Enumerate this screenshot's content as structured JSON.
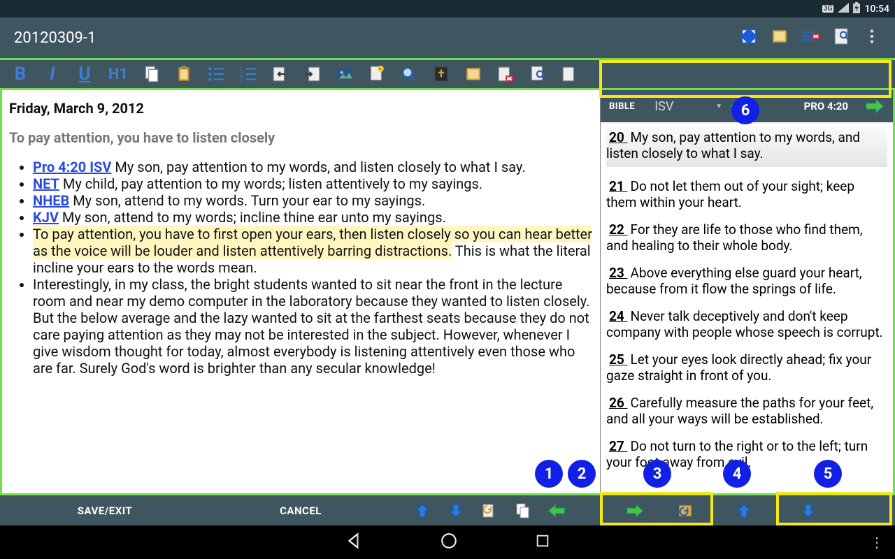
{
  "status": {
    "network": "3G",
    "time": "10:54"
  },
  "title": "20120309-1",
  "toolbar": {
    "bold": "B",
    "italic": "I",
    "underline": "U",
    "h1": "H1"
  },
  "editor": {
    "date": "Friday, March 9, 2012",
    "subtitle": "To pay attention, you have to listen closely",
    "items": [
      {
        "ref": "Pro 4:20 ISV",
        "text": " My son, pay attention to my words, and listen closely to what I say."
      },
      {
        "ref": "NET",
        "text": " My child, pay attention to my words; listen attentively to my sayings."
      },
      {
        "ref": "NHEB",
        "text": " My son, attend to my words. Turn your ear to my sayings."
      },
      {
        "ref": "KJV",
        "text": " My son, attend to my words; incline thine ear unto my sayings."
      }
    ],
    "highlight": "To pay attention, you have to first open your ears, then listen closely so you can hear better as the voice will be louder and listen attentively barring distractions.",
    "after_hl": " This is what the literal incline your ears to the words mean.",
    "note": "Interestingly, in my class, the bright students wanted to sit near the front in the lecture room and near my demo computer in the laboratory because they wanted to listen closely. But the below average and the lazy wanted to sit at the farthest seats because they do not care paying attention as they may not be interested in the subject. However, whenever I give wisdom thought for today, almost everybody is listening attentively even those who are far. Surely God's word is brighter than any secular knowledge!"
  },
  "bible": {
    "label": "BIBLE",
    "version": "ISV",
    "ref": "PRO 4:20",
    "verses": [
      {
        "n": "20",
        "t": " My son, pay attention to my words, and listen closely to what I say.",
        "active": true
      },
      {
        "n": "21",
        "t": " Do not let them out of your sight; keep them within your heart."
      },
      {
        "n": "22",
        "t": " For they are life to those who find them, and healing to their whole body."
      },
      {
        "n": "23",
        "t": " Above everything else guard your heart, because from it flow the springs of life."
      },
      {
        "n": "24",
        "t": " Never talk deceptively and don't keep company with people whose speech is corrupt."
      },
      {
        "n": "25",
        "t": " Let your eyes look directly ahead; fix your gaze straight in front of you."
      },
      {
        "n": "26",
        "t": " Carefully measure the paths for your feet, and all your ways will be established."
      },
      {
        "n": "27",
        "t": " Do not turn to the right or to the left; turn your foot away from evil."
      }
    ]
  },
  "bottom": {
    "save": "SAVE/EXIT",
    "cancel": "CANCEL"
  },
  "callouts": [
    "1",
    "2",
    "3",
    "4",
    "5",
    "6"
  ]
}
